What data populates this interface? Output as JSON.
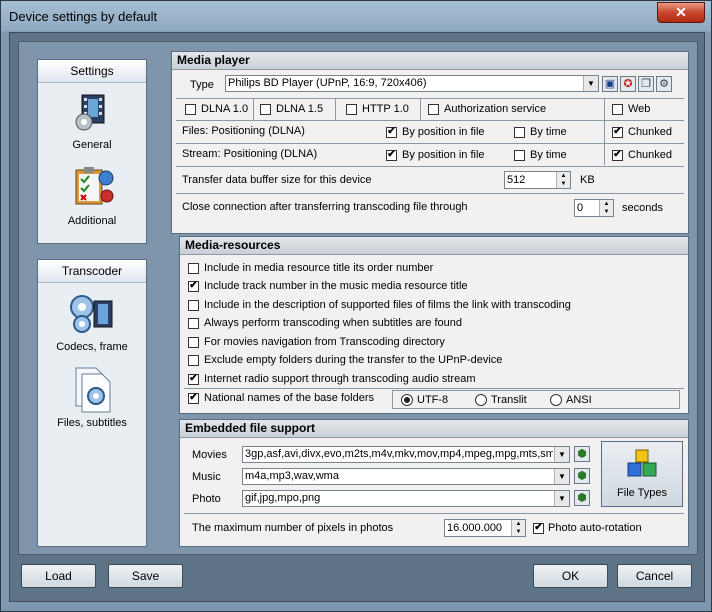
{
  "window": {
    "title": "Device settings by default",
    "close_glyph": "✕"
  },
  "nav": {
    "settings": {
      "header": "Settings",
      "items": [
        {
          "label": "General",
          "icon": "film-gear-icon"
        },
        {
          "label": "Additional",
          "icon": "clipboard-checklist-icon"
        }
      ]
    },
    "transcoder": {
      "header": "Transcoder",
      "items": [
        {
          "label": "Codecs, frame",
          "icon": "gears-film-icon"
        },
        {
          "label": "Files, subtitles",
          "icon": "file-gear-icon"
        }
      ]
    }
  },
  "media_player": {
    "header": "Media player",
    "type_label": "Type",
    "type_value": "Philips BD Player (UPnP, 16:9, 720x406)",
    "tools": [
      "save-icon",
      "lifebuoy-icon",
      "copy-icon",
      "settings-wheel-icon"
    ],
    "flags": [
      {
        "label": "DLNA 1.0",
        "checked": false
      },
      {
        "label": "DLNA 1.5",
        "checked": false
      },
      {
        "label": "HTTP 1.0",
        "checked": false
      },
      {
        "label": "Authorization service",
        "checked": false
      },
      {
        "label": "Web",
        "checked": false
      }
    ],
    "files_row": {
      "label": "Files: Positioning (DLNA)",
      "by_position": "By position in file",
      "by_position_checked": true,
      "by_time": "By time",
      "by_time_checked": false,
      "chunked": "Chunked",
      "chunked_checked": true
    },
    "stream_row": {
      "label": "Stream: Positioning (DLNA)",
      "by_position": "By position in file",
      "by_position_checked": true,
      "by_time": "By time",
      "by_time_checked": false,
      "chunked": "Chunked",
      "chunked_checked": true
    },
    "buffer": {
      "label": "Transfer data buffer size for this device",
      "value": "512",
      "unit": "KB"
    },
    "close_conn": {
      "label": "Close connection after transferring transcoding file through",
      "value": "0",
      "unit": "seconds"
    }
  },
  "media_resources": {
    "header": "Media-resources",
    "items": [
      {
        "label": "Include in media resource title its order number",
        "checked": false
      },
      {
        "label": "Include track number in the music media resource title",
        "checked": true
      },
      {
        "label": "Include in the description of supported files of films the link with transcoding",
        "checked": false
      },
      {
        "label": "Always perform transcoding when subtitles are found",
        "checked": false
      },
      {
        "label": "For movies navigation from Transcoding directory",
        "checked": false
      },
      {
        "label": "Exclude empty folders during the transfer to the UPnP-device",
        "checked": false
      },
      {
        "label": "Internet radio support through transcoding audio stream",
        "checked": true
      },
      {
        "label": "National names of the base folders",
        "checked": true
      }
    ],
    "encodings": [
      {
        "label": "UTF-8",
        "selected": true
      },
      {
        "label": "Translit",
        "selected": false
      },
      {
        "label": "ANSI",
        "selected": false
      }
    ]
  },
  "embedded": {
    "header": "Embedded file support",
    "rows": [
      {
        "label": "Movies",
        "value": "3gp,asf,avi,divx,evo,m2ts,m4v,mkv,mov,mp4,mpeg,mpg,mts,sm"
      },
      {
        "label": "Music",
        "value": "m4a,mp3,wav,wma"
      },
      {
        "label": "Photo",
        "value": "gif,jpg,mpo,png"
      }
    ],
    "file_types_label": "File Types",
    "pixels": {
      "label": "The maximum number of pixels in photos",
      "value": "16.000.000"
    },
    "autorotation": {
      "label": "Photo auto-rotation",
      "checked": true
    }
  },
  "buttons": {
    "load": "Load",
    "save": "Save",
    "ok": "OK",
    "cancel": "Cancel"
  }
}
